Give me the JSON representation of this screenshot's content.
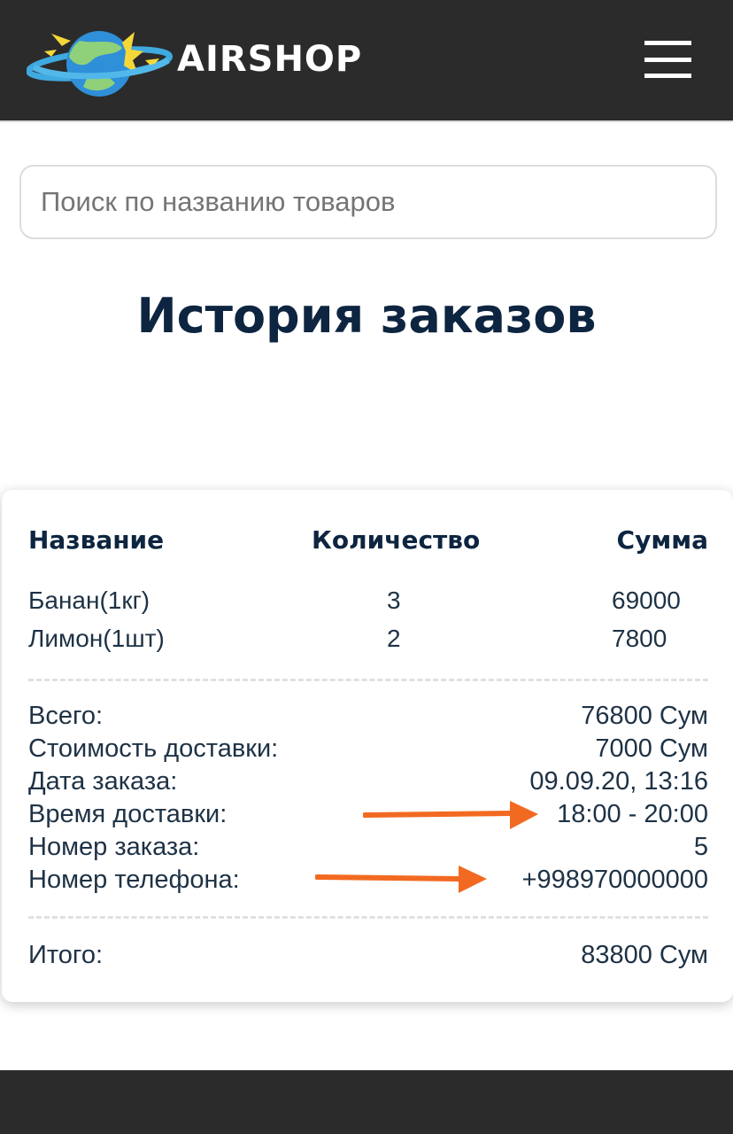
{
  "header": {
    "brand": "AIRSHOP",
    "logo_icon": "planet-logo-icon",
    "menu_icon": "hamburger-menu-icon"
  },
  "search": {
    "placeholder": "Поиск по названию товаров",
    "value": ""
  },
  "page_title": "История заказов",
  "order": {
    "columns": {
      "name": "Название",
      "quantity": "Количество",
      "sum": "Сумма"
    },
    "items": [
      {
        "name": "Банан(1кг)",
        "quantity": "3",
        "sum": "69000"
      },
      {
        "name": "Лимон(1шт)",
        "quantity": "2",
        "sum": "7800"
      }
    ],
    "details": [
      {
        "label": "Всего:",
        "value": "76800 Сум"
      },
      {
        "label": "Стоимость доставки:",
        "value": "7000 Сум"
      },
      {
        "label": "Дата заказа:",
        "value": "09.09.20, 13:16"
      },
      {
        "label": "Время доставки:",
        "value": "18:00 - 20:00"
      },
      {
        "label": "Номер заказа:",
        "value": "5"
      },
      {
        "label": "Номер телефона:",
        "value": "+998970000000"
      }
    ],
    "total": {
      "label": "Итого:",
      "value": "83800 Сум"
    }
  },
  "colors": {
    "header_bg": "#2b2b2b",
    "title": "#0d2540",
    "annotation_arrow": "#f26a21"
  }
}
